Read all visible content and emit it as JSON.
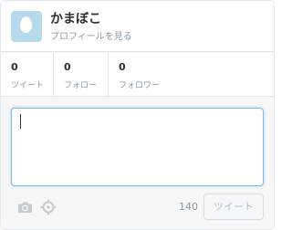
{
  "profile": {
    "name": "かまぼこ",
    "view_profile_label": "プロフィールを見る",
    "avatar_icon": "default-egg-avatar"
  },
  "stats": [
    {
      "count": "0",
      "label": "ツイート"
    },
    {
      "count": "0",
      "label": "フォロー"
    },
    {
      "count": "0",
      "label": "フォロワー"
    }
  ],
  "composer": {
    "value": "",
    "placeholder": ""
  },
  "toolbar": {
    "camera_icon": "camera-icon",
    "location_icon": "location-icon",
    "char_count": "140",
    "tweet_label": "ツイート"
  },
  "colors": {
    "accent": "#86b8e6",
    "avatar_bg": "#b6d9ec",
    "muted_text": "#8899a6"
  }
}
